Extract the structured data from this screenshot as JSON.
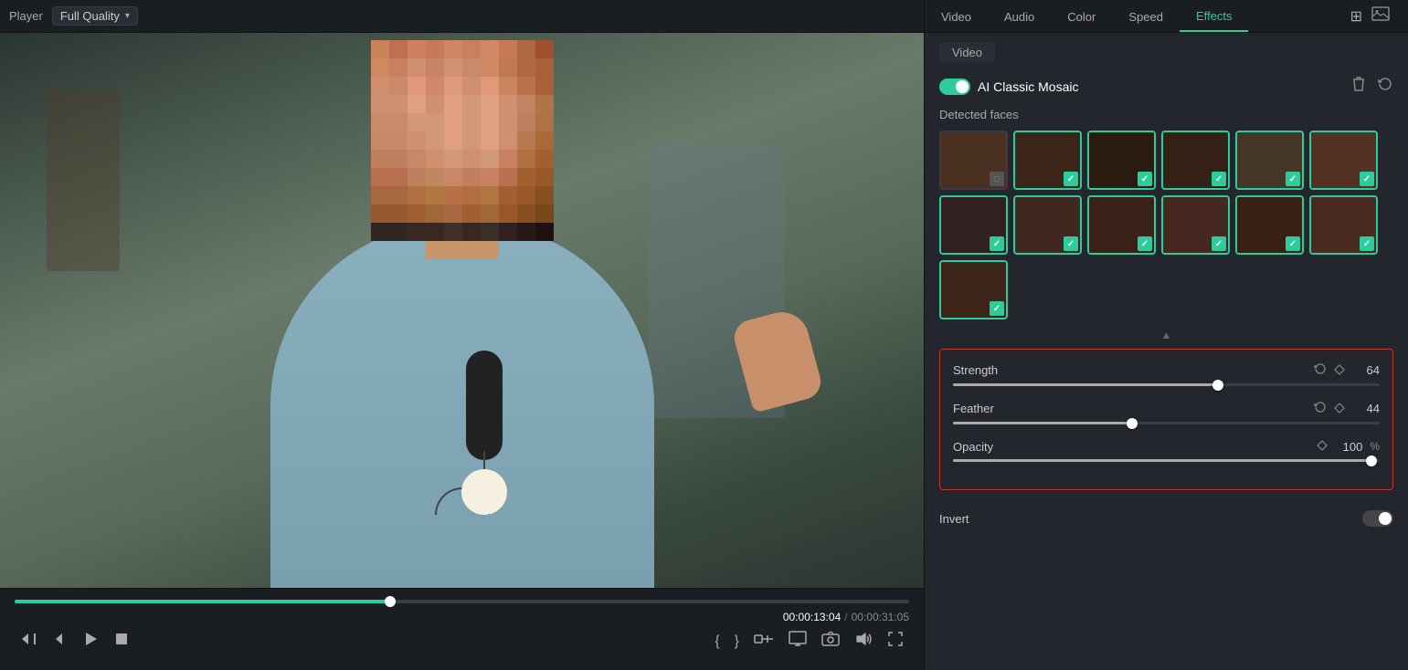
{
  "topbar": {
    "player_label": "Player",
    "quality_label": "Full Quality",
    "icon_grid": "⊞",
    "icon_image": "🖼"
  },
  "tabs": [
    {
      "id": "video",
      "label": "Video",
      "active": false
    },
    {
      "id": "audio",
      "label": "Audio",
      "active": false
    },
    {
      "id": "color",
      "label": "Color",
      "active": false
    },
    {
      "id": "speed",
      "label": "Speed",
      "active": false
    },
    {
      "id": "effects",
      "label": "Effects",
      "active": true
    }
  ],
  "sub_tab": "Video",
  "effect": {
    "name": "AI Classic Mosaic",
    "enabled": true
  },
  "detected_faces_label": "Detected faces",
  "faces": [
    {
      "id": 1,
      "selected": false,
      "bg": "face-bg-1"
    },
    {
      "id": 2,
      "selected": true,
      "bg": "face-bg-2"
    },
    {
      "id": 3,
      "selected": true,
      "bg": "face-bg-3"
    },
    {
      "id": 4,
      "selected": true,
      "bg": "face-bg-4"
    },
    {
      "id": 5,
      "selected": true,
      "bg": "face-bg-5"
    },
    {
      "id": 6,
      "selected": true,
      "bg": "face-bg-6"
    },
    {
      "id": 7,
      "selected": true,
      "bg": "face-bg-7"
    },
    {
      "id": 8,
      "selected": true,
      "bg": "face-bg-8"
    },
    {
      "id": 9,
      "selected": true,
      "bg": "face-bg-9"
    },
    {
      "id": 10,
      "selected": true,
      "bg": "face-bg-10"
    },
    {
      "id": 11,
      "selected": true,
      "bg": "face-bg-11"
    },
    {
      "id": 12,
      "selected": true,
      "bg": "face-bg-12"
    },
    {
      "id": 13,
      "selected": true,
      "bg": "face-bg-13"
    }
  ],
  "sliders": {
    "strength": {
      "label": "Strength",
      "value": 64,
      "percent": 62,
      "unit": ""
    },
    "feather": {
      "label": "Feather",
      "value": 44,
      "percent": 42,
      "unit": ""
    },
    "opacity": {
      "label": "Opacity",
      "value": 100,
      "percent": 98,
      "unit": "%"
    }
  },
  "invert_label": "Invert",
  "invert_enabled": false,
  "playback": {
    "current_time": "00:00:13:04",
    "total_time": "00:00:31:05",
    "separator": "/",
    "progress_percent": 42
  },
  "controls": {
    "back": "⏮",
    "step_back": "⏪",
    "play": "▶",
    "stop": "⏹",
    "bracket_open": "{",
    "bracket_close": "}",
    "trim": "⊳|",
    "monitor": "🖥",
    "camera": "📷",
    "volume": "🔊",
    "resize": "⤡"
  }
}
